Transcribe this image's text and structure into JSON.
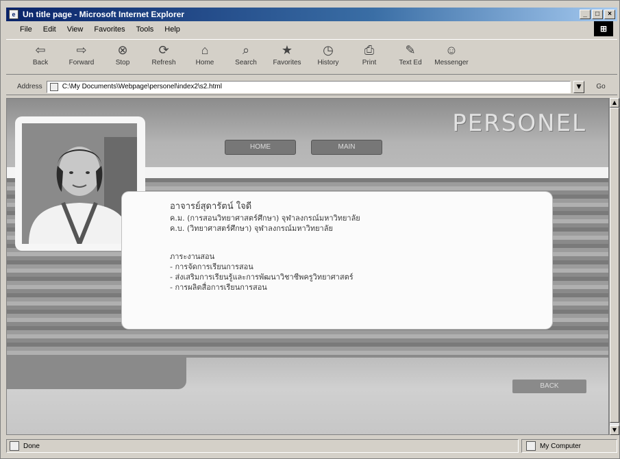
{
  "window": {
    "title": "Un title page - Microsoft Internet Explorer",
    "app_icon": "ie-page-icon",
    "controls": {
      "minimize": "_",
      "maximize": "□",
      "close": "×"
    }
  },
  "menu": [
    "File",
    "Edit",
    "View",
    "Favorites",
    "Tools",
    "Help"
  ],
  "toolbar": [
    {
      "label": "Back",
      "glyph": "⇦"
    },
    {
      "label": "Forward",
      "glyph": "⇨"
    },
    {
      "label": "Stop",
      "glyph": "⊗"
    },
    {
      "label": "Refresh",
      "glyph": "⟳"
    },
    {
      "label": "Home",
      "glyph": "⌂"
    },
    {
      "label": "Search",
      "glyph": "⌕"
    },
    {
      "label": "Favorites",
      "glyph": "★"
    },
    {
      "label": "History",
      "glyph": "◷"
    },
    {
      "label": "Print",
      "glyph": "⎙"
    },
    {
      "label": "Text Ed",
      "glyph": "✎"
    },
    {
      "label": "Messenger",
      "glyph": "☺"
    }
  ],
  "address": {
    "label": "Address",
    "value": "C:\\My Documents\\Webpage\\personel\\index2\\s2.html",
    "go_label": "Go"
  },
  "page": {
    "site_title": "PERSONEL",
    "nav": {
      "home": "HOME",
      "main": "MAIN"
    },
    "card": {
      "name": "อาจารย์สุดารัตน์ ใจดี",
      "degree1": "ค.ม. (การสอนวิทยาศาสตร์ศึกษา) จุฬาลงกรณ์มหาวิทยาลัย",
      "degree2": "ค.บ. (วิทยาศาสตร์ศึกษา) จุฬาลงกรณ์มหาวิทยาลัย",
      "section_title": "ภาระงานสอน",
      "items": [
        "- การจัดการเรียนการสอน",
        "- ส่งเสริมการเรียนรู้และการพัฒนาวิชาชีพครูวิทยาศาสตร์",
        "- การผลิตสื่อการเรียนการสอน"
      ]
    },
    "back_button": "BACK"
  },
  "status": {
    "left": "Done",
    "zone": "My Computer"
  }
}
